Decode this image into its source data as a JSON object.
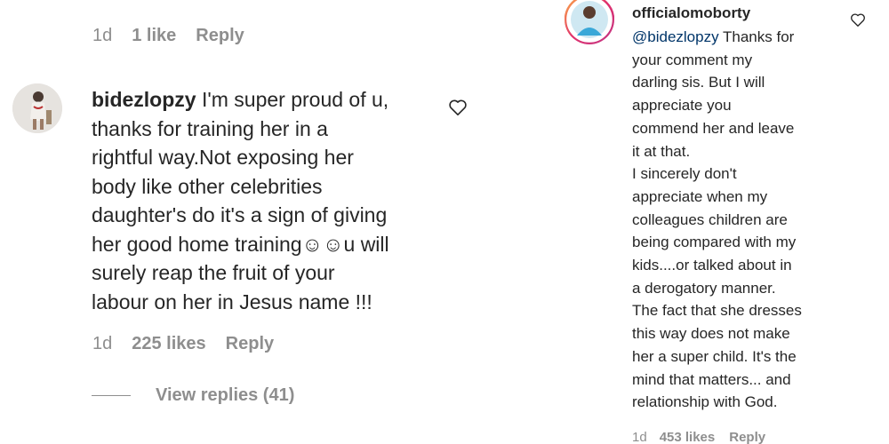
{
  "left_top_meta": {
    "time": "1d",
    "likes": "1 like",
    "reply": "Reply"
  },
  "comment": {
    "username": "bidezlopzy",
    "lines": [
      "I'm super proud of u,",
      "thanks for training her in a",
      "rightful way.Not exposing her",
      "body like other celebrities",
      "daughter's do it's a sign of giving",
      "her good home training☺☺u will",
      "surely reap the fruit of your",
      "labour on her in Jesus name !!!"
    ],
    "meta": {
      "time": "1d",
      "likes": "225 likes",
      "reply": "Reply"
    },
    "view_replies": "View replies (41)"
  },
  "reply_comment": {
    "username": "officialomoborty",
    "mention": "@bidezlopzy",
    "first_line_rest": " Thanks for",
    "lines": [
      "your comment my",
      "darling sis. But I will",
      "appreciate you",
      "commend her and leave",
      "it at that.",
      "I sincerely don't",
      "appreciate when my",
      "colleagues children are",
      "being compared with my",
      "kids....or talked about in",
      "a derogatory manner.",
      "The fact that she dresses",
      "this way does not make",
      "her a super child. It's the",
      "mind that matters... and",
      "relationship with God."
    ],
    "meta": {
      "time": "1d",
      "likes": "453 likes",
      "reply": "Reply"
    }
  },
  "colors": {
    "text": "#262626",
    "muted": "#8e8e8e",
    "mention": "#003569"
  }
}
